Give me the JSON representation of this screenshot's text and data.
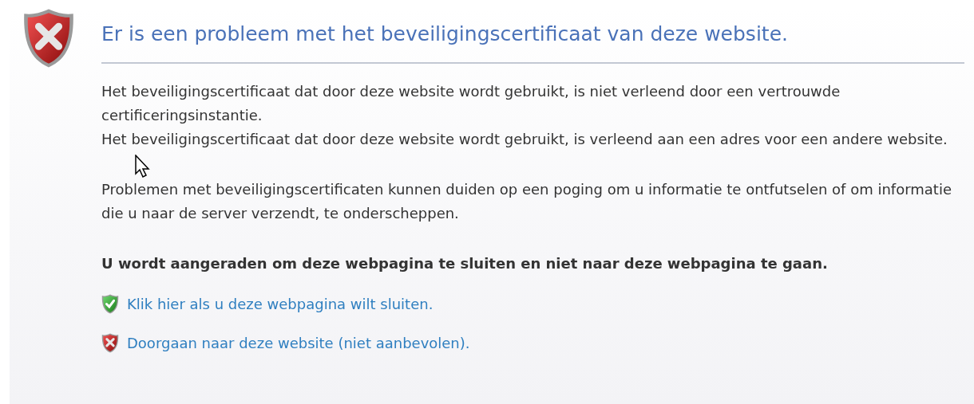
{
  "title": "Er is een probleem met het beveiligingscertificaat van deze website.",
  "reasons": [
    "Het beveiligingscertificaat dat door deze website wordt gebruikt, is niet verleend door een vertrouwde certificeringsinstantie.",
    "Het beveiligingscertificaat dat door deze website wordt gebruikt, is verleend aan een adres voor een andere website."
  ],
  "explanation": "Problemen met beveiligingscertificaten kunnen duiden op een poging om u informatie te ontfutselen of om informatie die u naar de server verzendt, te onderscheppen.",
  "recommendation": "U wordt aangeraden om deze webpagina te sluiten en niet naar deze webpagina te gaan.",
  "actions": [
    {
      "kind": "safe",
      "label": "Klik hier als u deze webpagina wilt sluiten."
    },
    {
      "kind": "unsafe",
      "label": "Doorgaan naar deze website (niet aanbevolen)."
    }
  ]
}
